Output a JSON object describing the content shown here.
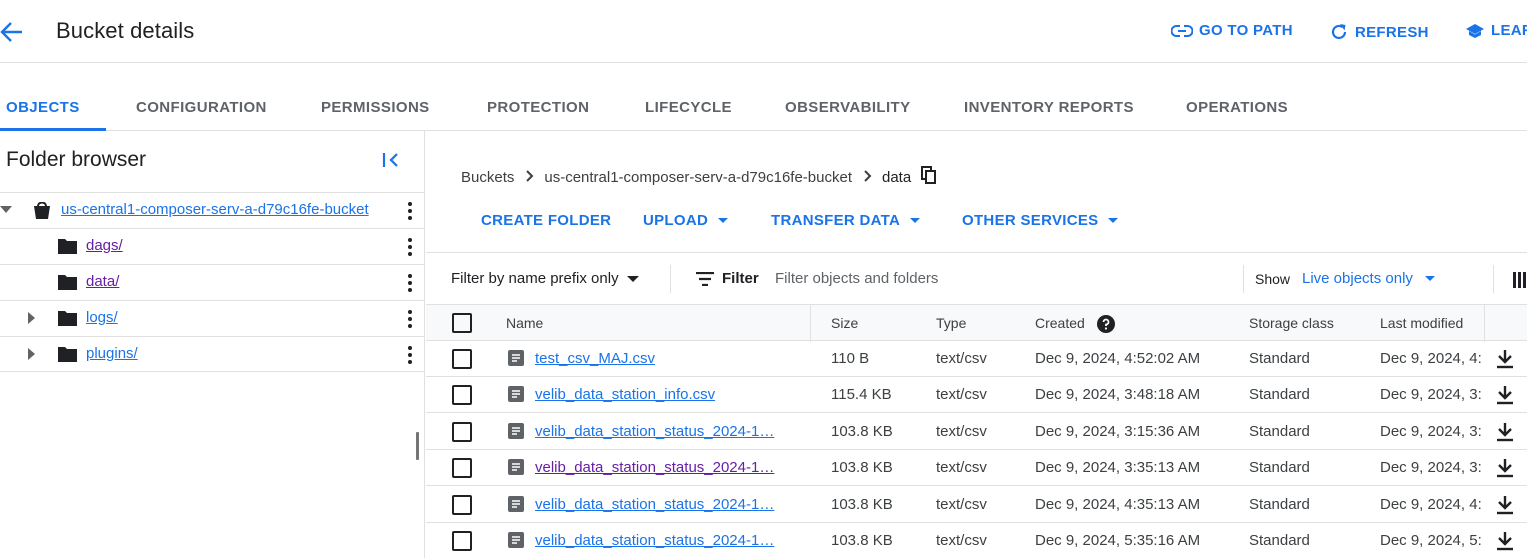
{
  "header": {
    "title": "Bucket details",
    "actions": [
      {
        "label": "GO TO PATH",
        "icon": "link-icon"
      },
      {
        "label": "REFRESH",
        "icon": "refresh-icon"
      },
      {
        "label": "LEAR",
        "icon": "school-icon"
      }
    ]
  },
  "tabs": [
    "OBJECTS",
    "CONFIGURATION",
    "PERMISSIONS",
    "PROTECTION",
    "LIFECYCLE",
    "OBSERVABILITY",
    "INVENTORY REPORTS",
    "OPERATIONS"
  ],
  "active_tab": "OBJECTS",
  "folder_browser": {
    "title": "Folder browser",
    "bucket": "us-central1-composer-serv-a-d79c16fe-bucket",
    "folders": [
      "dags/",
      "data/",
      "logs/",
      "plugins/"
    ]
  },
  "breadcrumb": {
    "root": "Buckets",
    "bucket": "us-central1-composer-serv-a-d79c16fe-bucket",
    "current": "data"
  },
  "toolbar": {
    "create_folder": "CREATE FOLDER",
    "upload": "UPLOAD",
    "transfer_data": "TRANSFER DATA",
    "other_services": "OTHER SERVICES"
  },
  "filter": {
    "mode": "Filter by name prefix only",
    "label": "Filter",
    "placeholder": "Filter objects and folders",
    "show_label": "Show",
    "show_value": "Live objects only"
  },
  "table": {
    "columns": [
      "Name",
      "Size",
      "Type",
      "Created",
      "Storage class",
      "Last modified"
    ],
    "rows": [
      {
        "name": "test_csv_MAJ.csv",
        "size": "110 B",
        "type": "text/csv",
        "created": "Dec 9, 2024, 4:52:02 AM",
        "storage": "Standard",
        "modified": "Dec 9, 2024, 4:",
        "visited": false
      },
      {
        "name": "velib_data_station_info.csv",
        "size": "115.4 KB",
        "type": "text/csv",
        "created": "Dec 9, 2024, 3:48:18 AM",
        "storage": "Standard",
        "modified": "Dec 9, 2024, 3:",
        "visited": false
      },
      {
        "name": "velib_data_station_status_2024-1…",
        "size": "103.8 KB",
        "type": "text/csv",
        "created": "Dec 9, 2024, 3:15:36 AM",
        "storage": "Standard",
        "modified": "Dec 9, 2024, 3:",
        "visited": false
      },
      {
        "name": "velib_data_station_status_2024-1…",
        "size": "103.8 KB",
        "type": "text/csv",
        "created": "Dec 9, 2024, 3:35:13 AM",
        "storage": "Standard",
        "modified": "Dec 9, 2024, 3:",
        "visited": true
      },
      {
        "name": "velib_data_station_status_2024-1…",
        "size": "103.8 KB",
        "type": "text/csv",
        "created": "Dec 9, 2024, 4:35:13 AM",
        "storage": "Standard",
        "modified": "Dec 9, 2024, 4:",
        "visited": false
      },
      {
        "name": "velib_data_station_status_2024-1…",
        "size": "103.8 KB",
        "type": "text/csv",
        "created": "Dec 9, 2024, 5:35:16 AM",
        "storage": "Standard",
        "modified": "Dec 9, 2024, 5:",
        "visited": false
      }
    ]
  },
  "colors": {
    "accent": "#1a73e8",
    "visited": "#681da8"
  }
}
